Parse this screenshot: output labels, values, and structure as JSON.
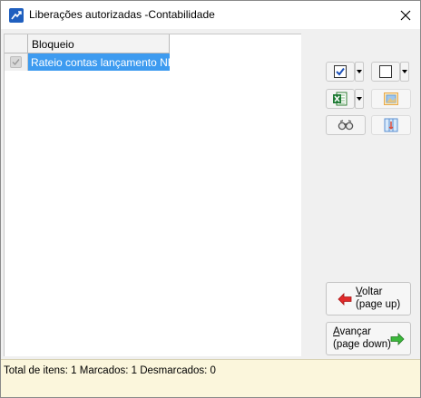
{
  "window": {
    "title": "Liberações autorizadas -Contabilidade"
  },
  "grid": {
    "columns": [
      "Bloqueio"
    ],
    "rows": [
      {
        "checked": true,
        "bloqueio": "Rateio contas lançamento NF",
        "selected": true
      }
    ]
  },
  "toolbar": {
    "check_all_icon": "checkbox-checked-icon",
    "uncheck_all_icon": "checkbox-empty-icon",
    "export_icon": "excel-icon",
    "image_icon": "image-icon",
    "find_icon": "binoculars-icon",
    "columns_icon": "columns-icon"
  },
  "nav": {
    "back_label_1": "Voltar",
    "back_label_1_accel": "V",
    "back_label_1_rest": "oltar",
    "back_label_2": "(page up)",
    "next_label_1_accel": "A",
    "next_label_1_rest": "vançar",
    "next_label_2": "(page down)"
  },
  "status": {
    "text": "Total de itens: 1 Marcados: 1 Desmarcados: 0"
  },
  "colors": {
    "selection": "#3d9bf0",
    "status_bg": "#fbf6dc",
    "arrow_back": "#e02a2a",
    "arrow_next": "#3cb83c"
  }
}
